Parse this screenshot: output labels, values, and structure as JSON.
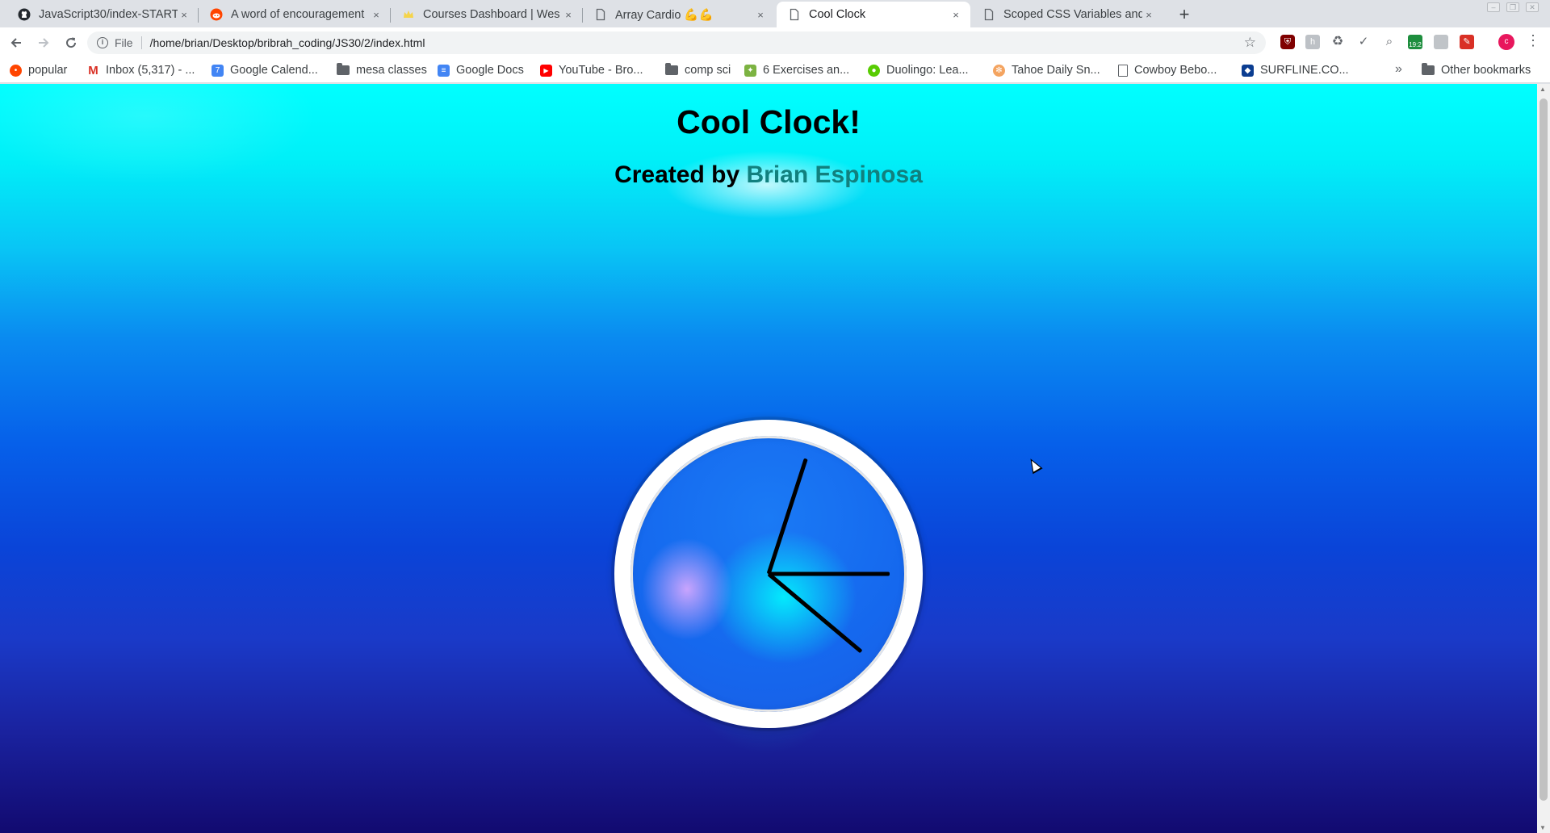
{
  "browser": {
    "tabs": [
      {
        "title": "JavaScript30/index-START",
        "icon": "github-icon",
        "active": false
      },
      {
        "title": "A word of encouragement",
        "icon": "reddit-icon",
        "active": false
      },
      {
        "title": "Courses Dashboard | Wes",
        "icon": "crown-icon",
        "active": false
      },
      {
        "title": "Array Cardio 💪💪",
        "icon": "document-icon",
        "active": false
      },
      {
        "title": "Cool Clock",
        "icon": "document-icon",
        "active": true
      },
      {
        "title": "Scoped CSS Variables and",
        "icon": "document-icon",
        "active": false
      }
    ],
    "new_tab_label": "+",
    "close_glyph": "×",
    "omnibox": {
      "scheme_label": "File",
      "url": "/home/brian/Desktop/bribrah_coding/JS30/2/index.html"
    },
    "profile_initial": "c",
    "extension_badge": "19:2",
    "bookmarks": [
      {
        "label": "popular",
        "icon": "reddit-icon"
      },
      {
        "label": "Inbox (5,317) - ...",
        "icon": "gmail-icon"
      },
      {
        "label": "Google Calend...",
        "icon": "calendar-icon"
      },
      {
        "label": "mesa classes",
        "icon": "folder-icon"
      },
      {
        "label": "Google Docs",
        "icon": "docs-icon"
      },
      {
        "label": "YouTube - Bro...",
        "icon": "youtube-icon"
      },
      {
        "label": "comp sci",
        "icon": "folder-icon"
      },
      {
        "label": "6 Exercises an...",
        "icon": "exercise-icon"
      },
      {
        "label": "Duolingo: Lea...",
        "icon": "duolingo-icon"
      },
      {
        "label": "Tahoe Daily Sn...",
        "icon": "snow-icon"
      },
      {
        "label": "Cowboy Bebo...",
        "icon": "document-icon"
      },
      {
        "label": "SURFLINE.CO...",
        "icon": "surfline-icon"
      }
    ],
    "overflow_label": "»",
    "other_bookmarks": "Other bookmarks"
  },
  "page": {
    "title": "Cool Clock!",
    "subtitle_prefix": "Created by ",
    "author": "Brian Espinosa"
  },
  "clock": {
    "hour_angle_deg": -72,
    "minute_angle_deg": 0,
    "second_angle_deg": 40
  },
  "colors": {
    "accent_author": "#11807e",
    "bg_top": "#00ffff",
    "bg_bottom": "#120a70"
  }
}
